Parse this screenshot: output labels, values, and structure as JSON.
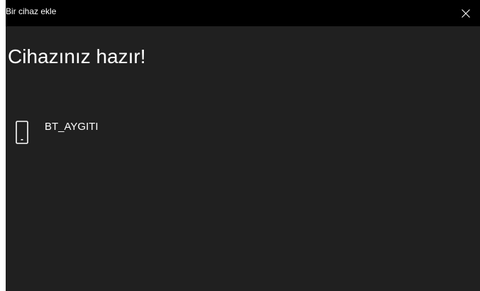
{
  "window": {
    "title": "Bir cihaz ekle"
  },
  "main": {
    "heading": "Cihazınız hazır!",
    "device": {
      "name": "BT_AYGITI",
      "icon": "phone-icon"
    }
  },
  "titlebar": {
    "close_icon": "close-icon"
  },
  "colors": {
    "titlebar_bg": "#000000",
    "window_bg": "#202020",
    "text": "#ffffff"
  }
}
